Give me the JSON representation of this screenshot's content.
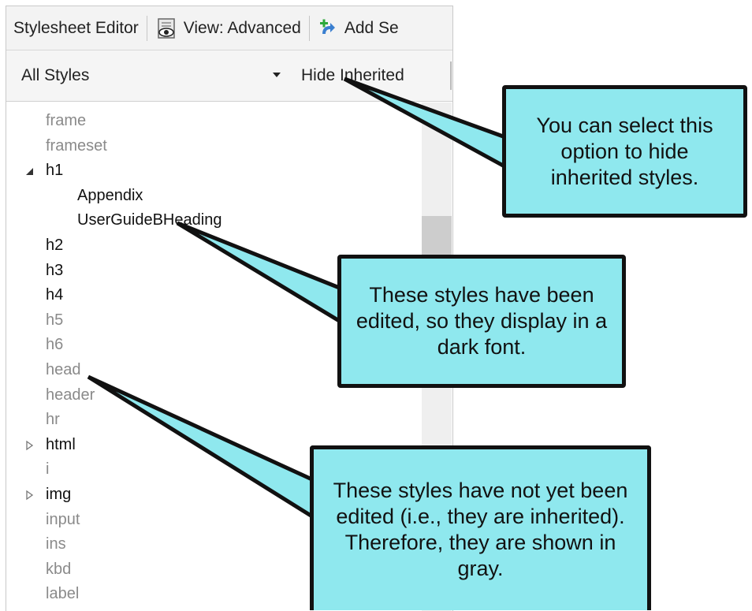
{
  "toolbar": {
    "title": "Stylesheet Editor",
    "view_label": "View: Advanced",
    "add_label": "Add Se"
  },
  "filter": {
    "dropdown_value": "All Styles",
    "hide_inherited_label": "Hide Inherited"
  },
  "tree": {
    "items": [
      {
        "label": "frame",
        "state": "inherited"
      },
      {
        "label": "frameset",
        "state": "inherited"
      },
      {
        "label": "h1",
        "state": "edited",
        "expander": "expanded"
      },
      {
        "label": "Appendix",
        "state": "edited"
      },
      {
        "label": "UserGuideBHeading",
        "state": "edited"
      },
      {
        "label": "h2",
        "state": "edited"
      },
      {
        "label": "h3",
        "state": "edited"
      },
      {
        "label": "h4",
        "state": "edited"
      },
      {
        "label": "h5",
        "state": "inherited"
      },
      {
        "label": "h6",
        "state": "inherited"
      },
      {
        "label": "head",
        "state": "inherited"
      },
      {
        "label": "header",
        "state": "inherited"
      },
      {
        "label": "hr",
        "state": "inherited"
      },
      {
        "label": "html",
        "state": "edited",
        "expander": "collapsed"
      },
      {
        "label": "i",
        "state": "inherited"
      },
      {
        "label": "img",
        "state": "edited",
        "expander": "collapsed"
      },
      {
        "label": "input",
        "state": "inherited"
      },
      {
        "label": "ins",
        "state": "inherited"
      },
      {
        "label": "kbd",
        "state": "inherited"
      },
      {
        "label": "label",
        "state": "inherited"
      }
    ]
  },
  "callouts": {
    "hide_inherited": "You can select this option to hide inherited styles.",
    "edited": "These styles have been edited, so they display in a dark font.",
    "inherited": "These styles have not yet been edited (i.e., they are inherited). Therefore, they are shown in gray."
  },
  "colors": {
    "callout_fill": "#8fe8ee",
    "callout_border": "#111111",
    "edited_text": "#111111",
    "inherited_text": "#8a8a8a"
  }
}
